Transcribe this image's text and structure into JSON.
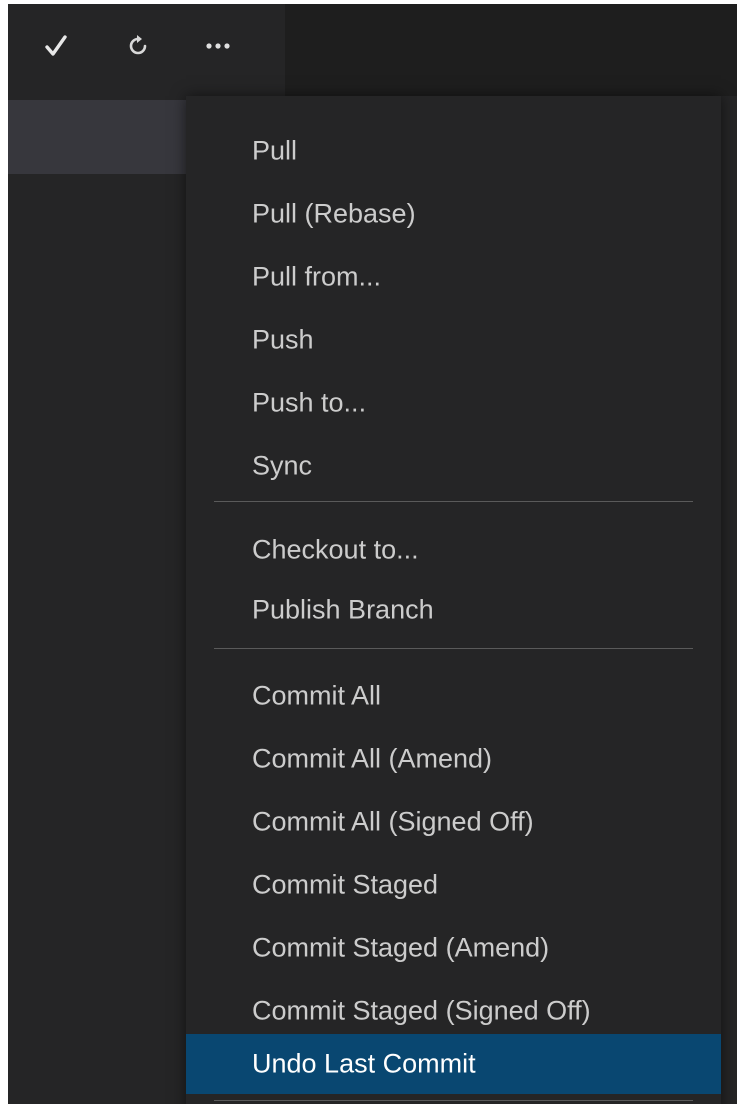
{
  "toolbar": {
    "buttons": [
      {
        "icon": "check-icon",
        "glyph": "✓"
      },
      {
        "icon": "refresh-icon",
        "glyph": "↻"
      },
      {
        "icon": "more-icon",
        "glyph": "···"
      }
    ]
  },
  "menu": {
    "groups": [
      {
        "items": [
          {
            "label": "Pull"
          },
          {
            "label": "Pull (Rebase)"
          },
          {
            "label": "Pull from..."
          },
          {
            "label": "Push"
          },
          {
            "label": "Push to..."
          },
          {
            "label": "Sync"
          }
        ]
      },
      {
        "items": [
          {
            "label": "Checkout to..."
          },
          {
            "label": "Publish Branch"
          }
        ]
      },
      {
        "items": [
          {
            "label": "Commit All"
          },
          {
            "label": "Commit All (Amend)"
          },
          {
            "label": "Commit All (Signed Off)"
          },
          {
            "label": "Commit Staged"
          },
          {
            "label": "Commit Staged (Amend)"
          },
          {
            "label": "Commit Staged (Signed Off)"
          },
          {
            "label": "Undo Last Commit",
            "highlighted": true
          }
        ]
      }
    ]
  },
  "colors": {
    "background": "#252526",
    "editor_background": "#1e1e1e",
    "selection": "#094771",
    "text": "#cccccc",
    "separator": "#5a5a5a"
  }
}
